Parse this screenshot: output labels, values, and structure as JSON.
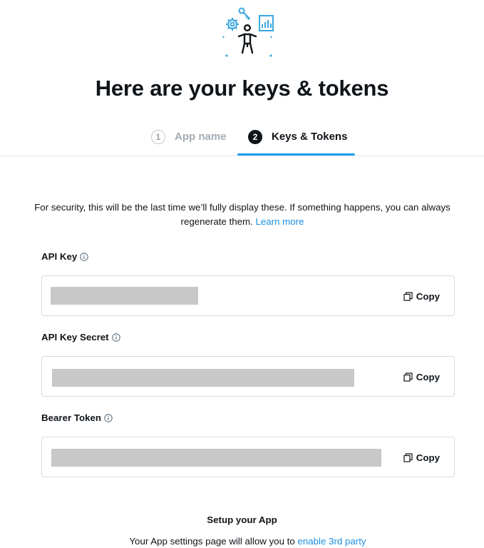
{
  "header": {
    "title": "Here are your keys & tokens",
    "illustration_icon": "developer-keys-illustration"
  },
  "stepper": {
    "steps": [
      {
        "number": "1",
        "label": "App name",
        "state": "inactive"
      },
      {
        "number": "2",
        "label": "Keys & Tokens",
        "state": "active"
      }
    ]
  },
  "notice": {
    "text": "For security, this will be the last time we’ll fully display these. If something happens, you can always regenerate them.",
    "link_label": "Learn more"
  },
  "fields": [
    {
      "label": "API Key",
      "value_hidden": true,
      "copy_label": "Copy"
    },
    {
      "label": "API Key Secret",
      "value_hidden": true,
      "copy_label": "Copy"
    },
    {
      "label": "Bearer Token",
      "value_hidden": true,
      "copy_label": "Copy"
    }
  ],
  "setup": {
    "title": "Setup your App",
    "text": "Your App settings page will allow you to",
    "link_label": "enable 3rd party"
  },
  "colors": {
    "accent": "#1d9bf0",
    "text": "#0f1419",
    "redaction": "#c8c8c8",
    "illustration_blue": "#57b8e8"
  }
}
